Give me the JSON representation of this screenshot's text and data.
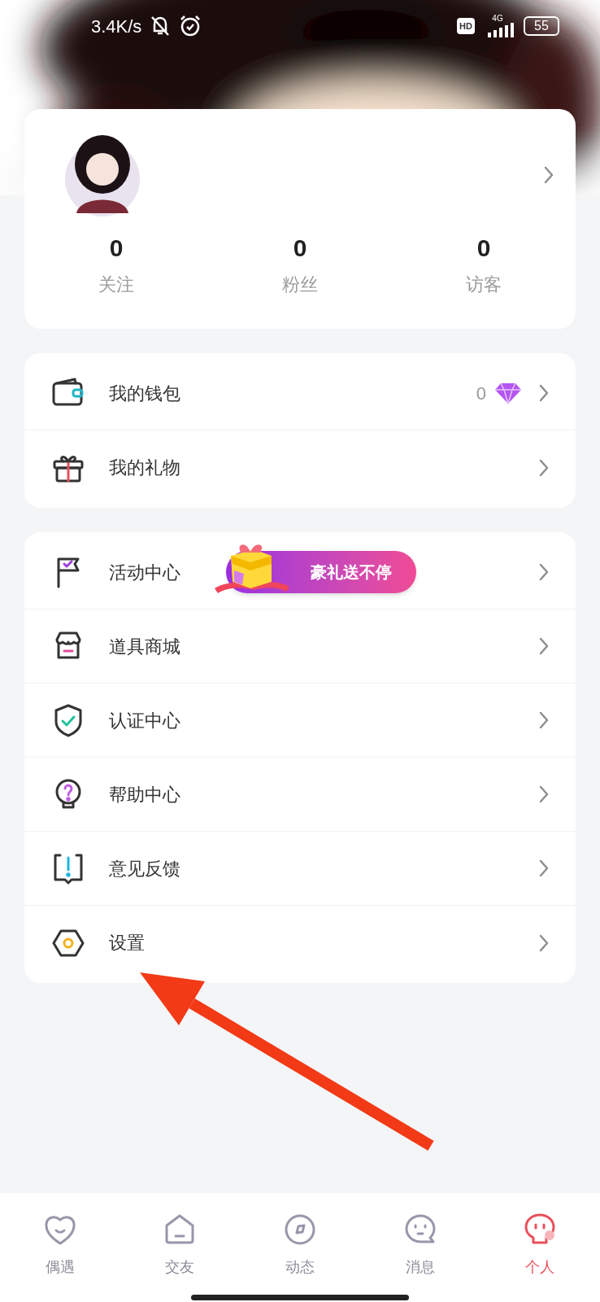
{
  "status_bar": {
    "speed": "3.4K/s",
    "hd": "HD",
    "network": "4G",
    "battery": "55"
  },
  "profile": {
    "stats": [
      {
        "value": "0",
        "label": "关注"
      },
      {
        "value": "0",
        "label": "粉丝"
      },
      {
        "value": "0",
        "label": "访客"
      }
    ]
  },
  "wallet_menu": [
    {
      "label": "我的钱包",
      "value": "0"
    },
    {
      "label": "我的礼物"
    }
  ],
  "service_menu": [
    {
      "label": "活动中心",
      "banner": "豪礼送不停"
    },
    {
      "label": "道具商城"
    },
    {
      "label": "认证中心"
    },
    {
      "label": "帮助中心"
    },
    {
      "label": "意见反馈"
    },
    {
      "label": "设置"
    }
  ],
  "tabs": [
    {
      "label": "偶遇",
      "selected": false
    },
    {
      "label": "交友",
      "selected": false
    },
    {
      "label": "动态",
      "selected": false
    },
    {
      "label": "消息",
      "selected": false
    },
    {
      "label": "个人",
      "selected": true
    }
  ]
}
